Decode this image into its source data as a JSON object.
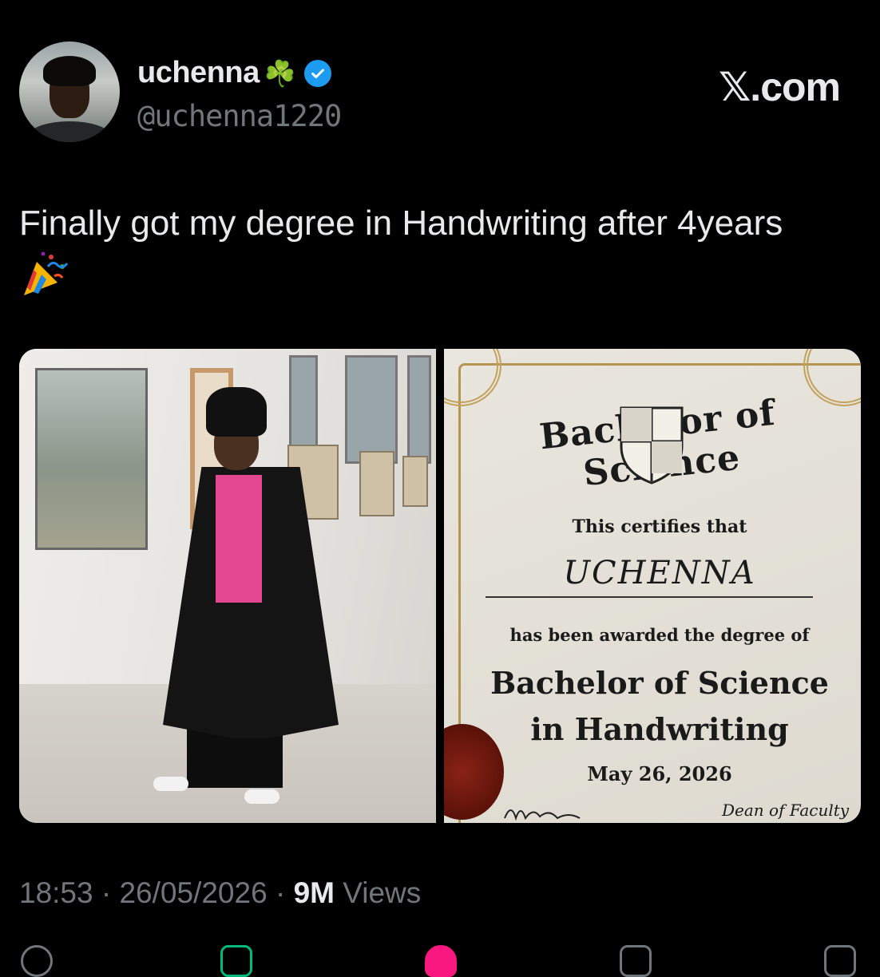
{
  "user": {
    "display_name": "uchenna",
    "name_emoji": "☘️",
    "handle": "@uchenna1220",
    "verified": true
  },
  "brand": "𝕏.com",
  "tweet": {
    "text": "Finally got my degree in Handwriting  after 4years",
    "emoji": "🎉"
  },
  "certificate": {
    "title": "Bachelor of Science",
    "certifies": "This certifies that",
    "recipient": "UCHENNA",
    "awarded": "has been awarded the degree of",
    "degree_line1": "Bachelor of Science",
    "degree_line2": "in Handwriting",
    "date": "May 26, 2026",
    "dean_label": "Dean of Faculty"
  },
  "meta": {
    "time": "18:53",
    "date": "26/05/2026",
    "views_count": "9M",
    "views_label": "Views"
  },
  "colors": {
    "background": "#000000",
    "text": "#e7e9ea",
    "muted": "#71767b",
    "verified": "#1d9bf0",
    "like": "#f91880",
    "repost": "#00ba7c"
  }
}
